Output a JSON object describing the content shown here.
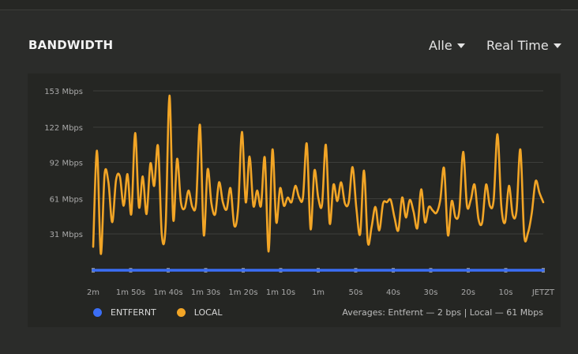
{
  "panel": {
    "title": "BANDWIDTH",
    "filter_dropdown": "Alle",
    "range_dropdown": "Real Time"
  },
  "legend": {
    "remote": "ENTFERNT",
    "local": "LOCAL",
    "averages": "Averages: Entfernt — 2 bps | Local — 61 Mbps"
  },
  "colors": {
    "remote": "#3b6ef5",
    "local": "#f2a526",
    "grid": "#3d3e3b",
    "background": "#252623"
  },
  "chart_data": {
    "type": "line",
    "y_unit": "Mbps",
    "ylim": [
      0,
      153
    ],
    "y_ticks": [
      31,
      61,
      92,
      122,
      153
    ],
    "y_tick_labels": [
      "31 Mbps",
      "61 Mbps",
      "92 Mbps",
      "122 Mbps",
      "153 Mbps"
    ],
    "x_tick_labels": [
      "2m",
      "1m 50s",
      "1m 40s",
      "1m 30s",
      "1m 20s",
      "1m 10s",
      "1m",
      "50s",
      "40s",
      "30s",
      "20s",
      "10s",
      "JETZT"
    ],
    "series": [
      {
        "name": "ENTFERNT",
        "values": [
          0,
          0,
          0,
          0,
          0,
          0,
          0,
          0,
          0,
          0,
          0,
          0,
          0
        ]
      },
      {
        "name": "LOCAL",
        "values": [
          20,
          102,
          14,
          82,
          75,
          41,
          77,
          80,
          55,
          82,
          48,
          117,
          54,
          80,
          48,
          91,
          72,
          106,
          30,
          38,
          149,
          43,
          95,
          58,
          53,
          68,
          54,
          58,
          124,
          30,
          86,
          57,
          48,
          75,
          58,
          52,
          70,
          38,
          53,
          118,
          58,
          97,
          55,
          68,
          55,
          96,
          16,
          103,
          41,
          70,
          55,
          62,
          58,
          72,
          62,
          62,
          108,
          35,
          85,
          62,
          56,
          107,
          40,
          73,
          59,
          75,
          57,
          58,
          88,
          53,
          31,
          85,
          24,
          37,
          54,
          34,
          57,
          58,
          60,
          45,
          34,
          62,
          45,
          60,
          50,
          36,
          69,
          41,
          54,
          51,
          49,
          60,
          87,
          30,
          59,
          45,
          51,
          101,
          55,
          60,
          73,
          44,
          41,
          73,
          55,
          60,
          116,
          55,
          41,
          72,
          47,
          51,
          103,
          30,
          32,
          49,
          76,
          66,
          58
        ]
      }
    ],
    "grid": true,
    "legend_position": "bottom-left"
  }
}
